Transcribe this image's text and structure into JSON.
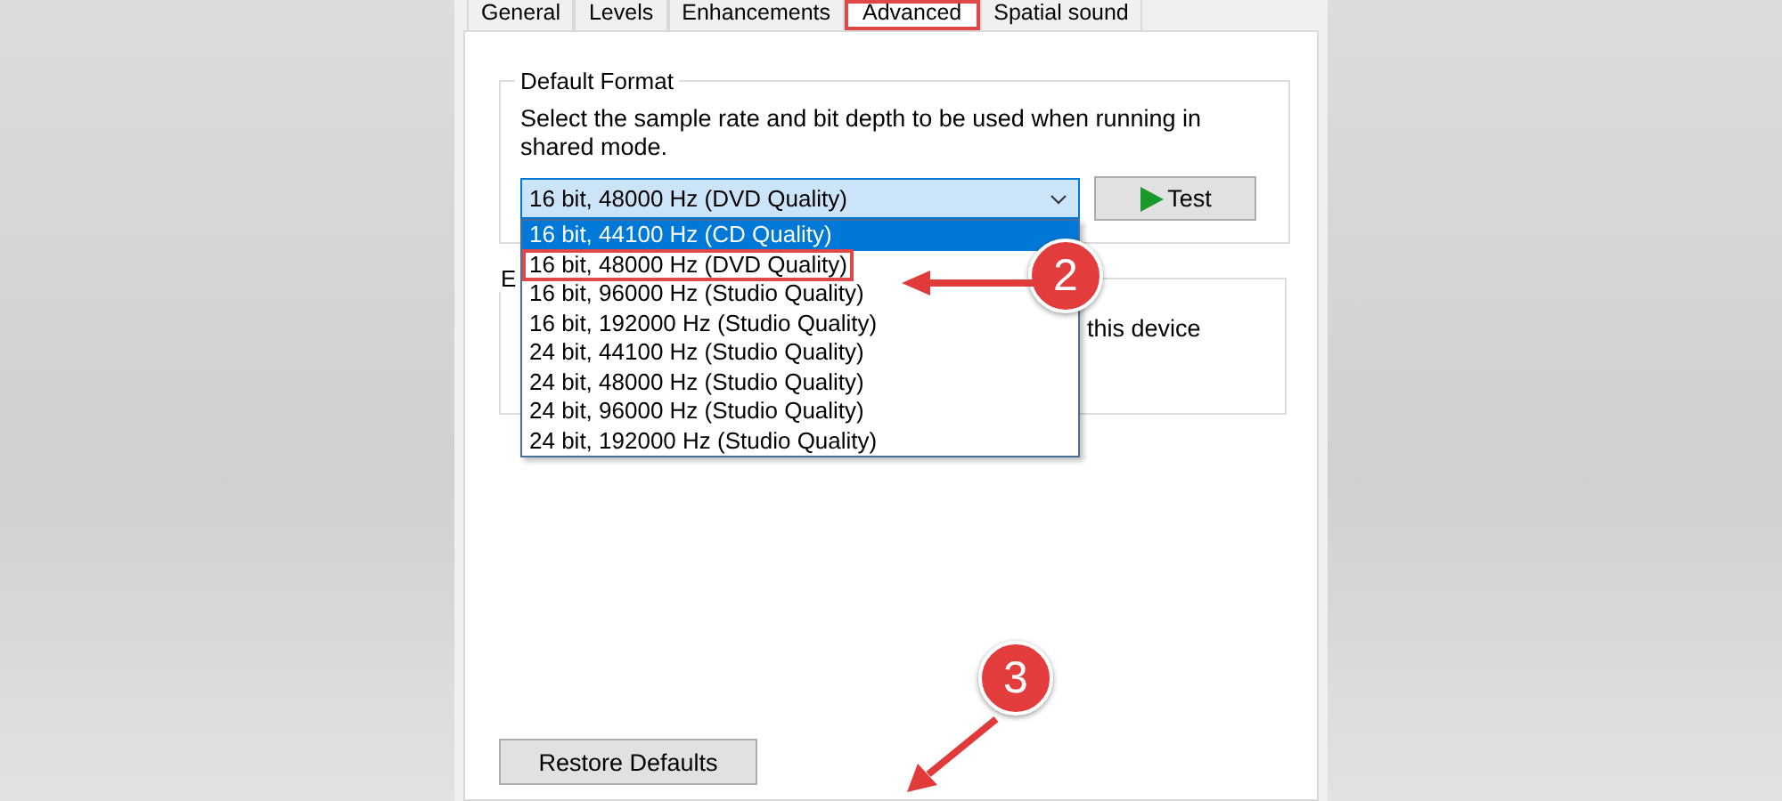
{
  "tabs": [
    {
      "label": "General",
      "selected": false,
      "highlighted": false
    },
    {
      "label": "Levels",
      "selected": false,
      "highlighted": false
    },
    {
      "label": "Enhancements",
      "selected": false,
      "highlighted": false
    },
    {
      "label": "Advanced",
      "selected": true,
      "highlighted": true
    },
    {
      "label": "Spatial sound",
      "selected": false,
      "highlighted": false
    }
  ],
  "default_format": {
    "title": "Default Format",
    "description": "Select the sample rate and bit depth to be used when running in shared mode.",
    "value": "16 bit, 48000 Hz (DVD Quality)",
    "test_button": "Test",
    "expanded": true,
    "options": [
      {
        "label": "16 bit, 44100 Hz (CD Quality)",
        "hovered": true,
        "highlighted": false
      },
      {
        "label": "16 bit, 48000 Hz (DVD Quality)",
        "hovered": false,
        "highlighted": true
      },
      {
        "label": "16 bit, 96000 Hz (Studio Quality)",
        "hovered": false,
        "highlighted": false
      },
      {
        "label": "16 bit, 192000 Hz (Studio Quality)",
        "hovered": false,
        "highlighted": false
      },
      {
        "label": "24 bit, 44100 Hz (Studio Quality)",
        "hovered": false,
        "highlighted": false
      },
      {
        "label": "24 bit, 48000 Hz (Studio Quality)",
        "hovered": false,
        "highlighted": false
      },
      {
        "label": "24 bit, 96000 Hz (Studio Quality)",
        "hovered": false,
        "highlighted": false
      },
      {
        "label": "24 bit, 192000 Hz (Studio Quality)",
        "hovered": false,
        "highlighted": false
      }
    ]
  },
  "exclusive_mode": {
    "title": "E",
    "text": "this device"
  },
  "restore_button": "Restore Defaults",
  "callouts": [
    {
      "number": "2"
    },
    {
      "number": "3"
    }
  ]
}
